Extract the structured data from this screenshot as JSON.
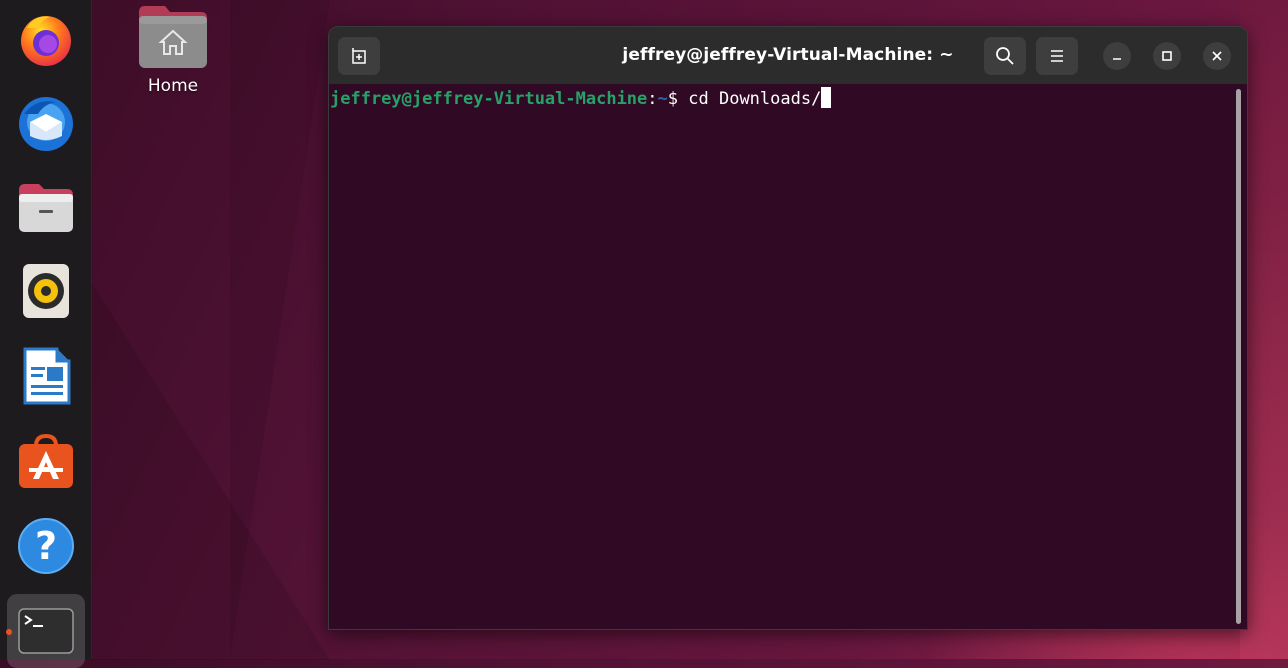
{
  "desktop": {
    "home_label": "Home"
  },
  "dock": {
    "items": [
      {
        "name": "firefox-icon"
      },
      {
        "name": "thunderbird-icon"
      },
      {
        "name": "files-icon"
      },
      {
        "name": "rhythmbox-icon"
      },
      {
        "name": "libreoffice-writer-icon"
      },
      {
        "name": "app-center-icon"
      },
      {
        "name": "help-icon"
      },
      {
        "name": "terminal-icon",
        "active": true
      }
    ]
  },
  "terminal": {
    "title": "jeffrey@jeffrey-Virtual-Machine: ~",
    "prompt_user": "jeffrey@jeffrey-Virtual-Machine",
    "prompt_sep": ":",
    "prompt_path": "~",
    "prompt_symbol": "$ ",
    "command": "cd Downloads/"
  },
  "colors": {
    "terminal_bg": "#300a24",
    "prompt_user": "#26a269",
    "prompt_path": "#3465a4",
    "titlebar": "#2c2c2c",
    "running_dot": "#e9541e"
  }
}
